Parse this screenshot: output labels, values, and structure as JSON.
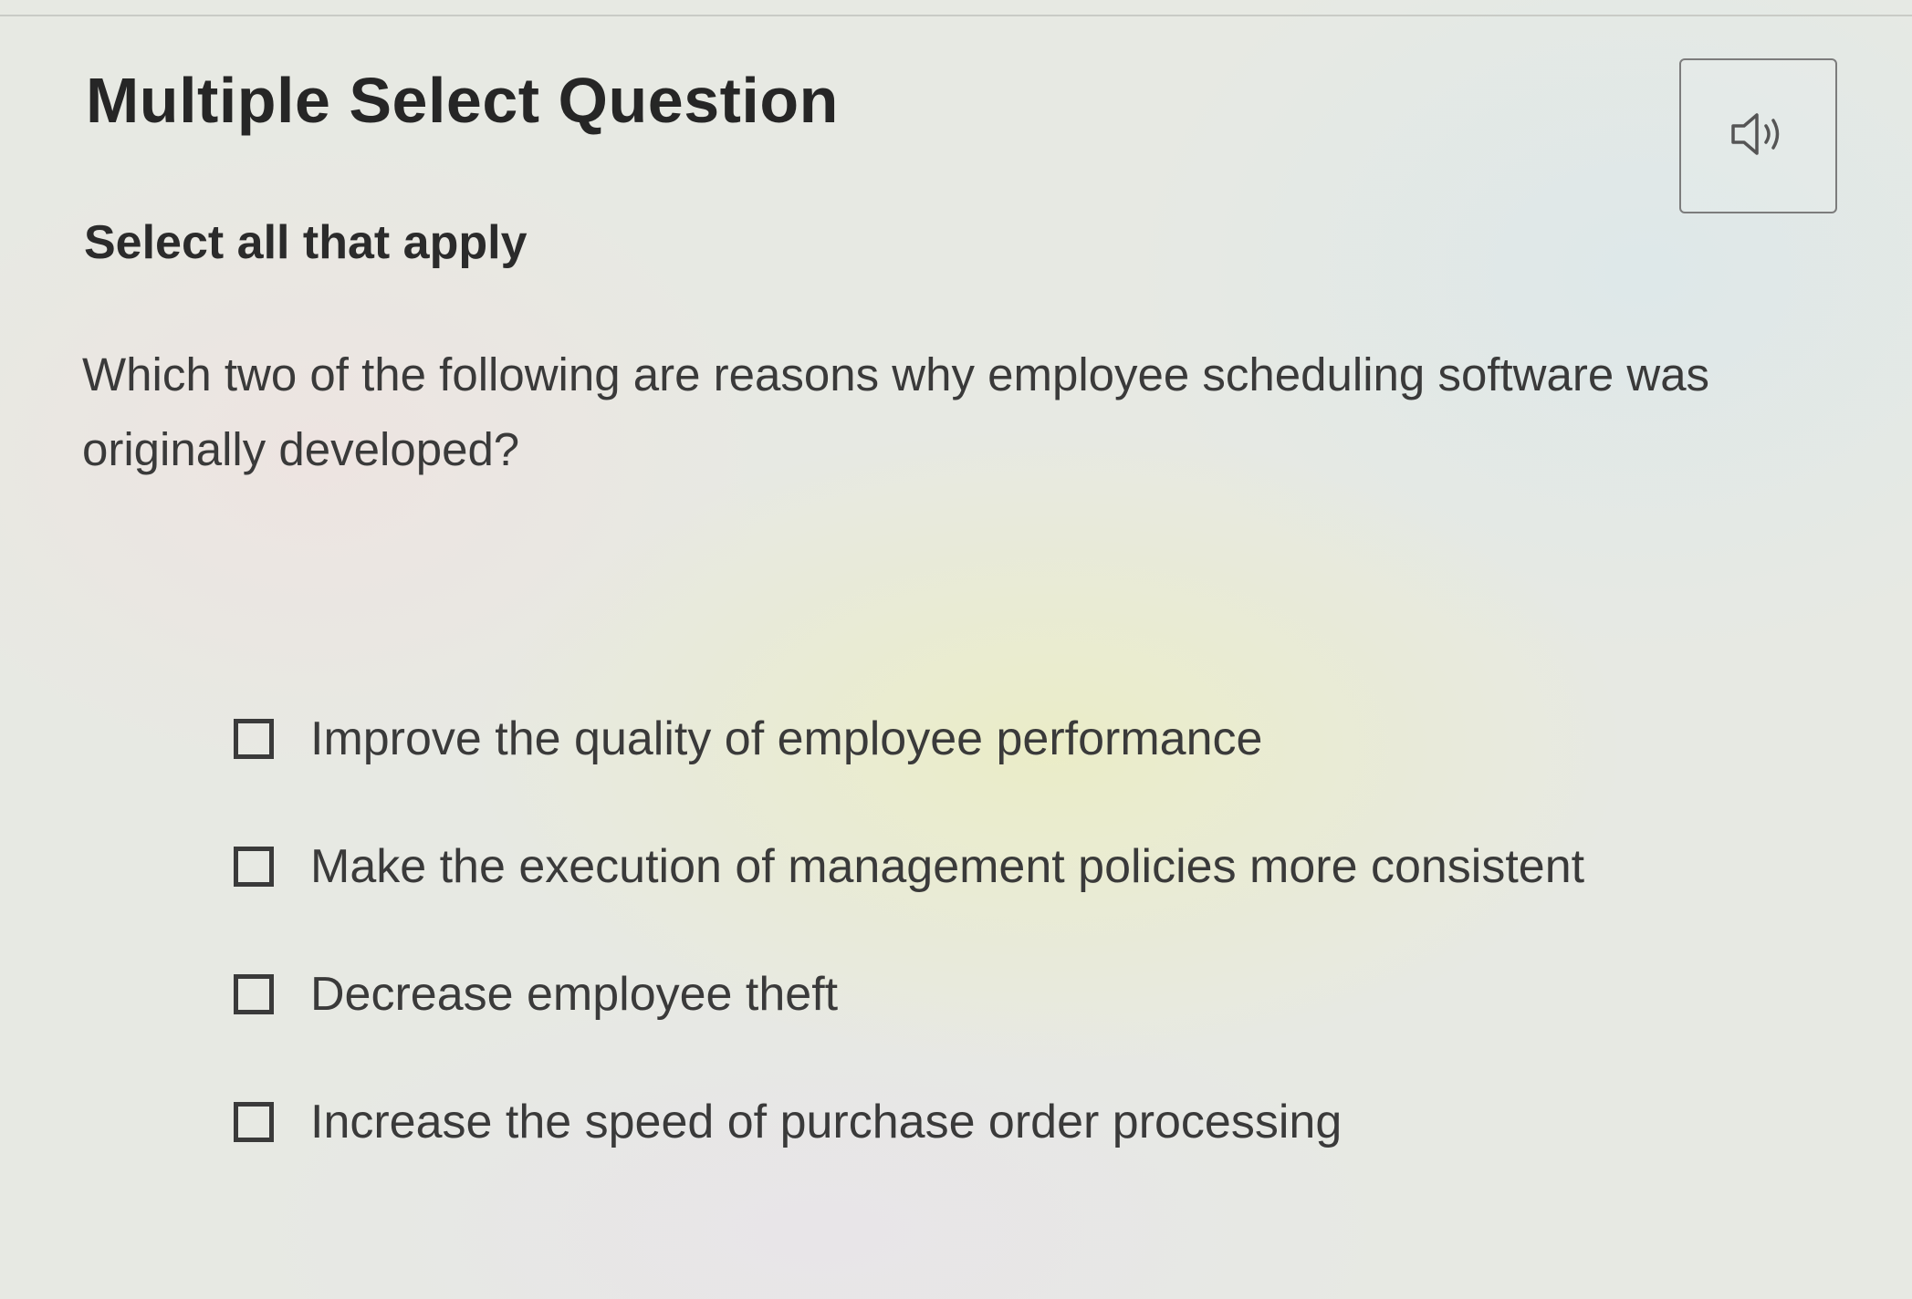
{
  "question": {
    "type_title": "Multiple Select Question",
    "instruction": "Select all that apply",
    "prompt": "Which two of the following are reasons why employee scheduling software was originally developed?"
  },
  "audio_button": {
    "icon": "speaker-icon"
  },
  "options": [
    {
      "label": "Improve the quality of employee performance",
      "checked": false
    },
    {
      "label": "Make the execution of management policies more consistent",
      "checked": false
    },
    {
      "label": "Decrease employee theft",
      "checked": false
    },
    {
      "label": "Increase the speed of purchase order processing",
      "checked": false
    }
  ]
}
